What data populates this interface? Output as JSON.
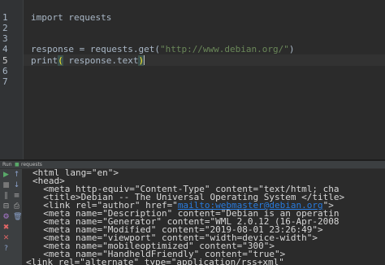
{
  "editor": {
    "line_numbers": [
      "1",
      "2",
      "3",
      "4",
      "5",
      "6",
      "7"
    ],
    "line1": {
      "kw": "import",
      "rest": " requests"
    },
    "line4": {
      "pre": "response = requests.get(",
      "url": "\"http://www.debian.org/\"",
      "post": ")"
    },
    "line5": {
      "fn": "print",
      "open": "(",
      "mid": " response.text",
      "close": ")"
    }
  },
  "run_panel": {
    "tab_run": "Run",
    "tab_name": "requests"
  },
  "console": {
    "lines": [
      "<html lang=\"en\">",
      "<head>",
      "  <meta http-equiv=\"Content-Type\" content=\"text/html; cha",
      "  <title>Debian -- The Universal Operating System </title>",
      "  <link rel=\"author\" href=\"",
      "  <meta name=\"Description\" content=\"Debian is an operatin",
      "  <meta name=\"Generator\" content=\"WML 2.0.12 (16-Apr-2008",
      "  <meta name=\"Modified\" content=\"2019-08-01 23:26:49\">",
      "  <meta name=\"viewport\" content=\"width=device-width\">",
      "  <meta name=\"mobileoptimized\" content=\"300\">",
      "  <meta name=\"HandheldFriendly\" content=\"true\">",
      "<link rel=\"alternate\" type=\"application/rss+xml\""
    ],
    "author_link": "mailto:webmaster@debian.org",
    "author_tail": "\">"
  },
  "colors": {
    "background": "#2b2b2b",
    "string": "#6a8759",
    "keyword": "#cc7832",
    "link": "#287bde",
    "run_green": "#59a869"
  }
}
